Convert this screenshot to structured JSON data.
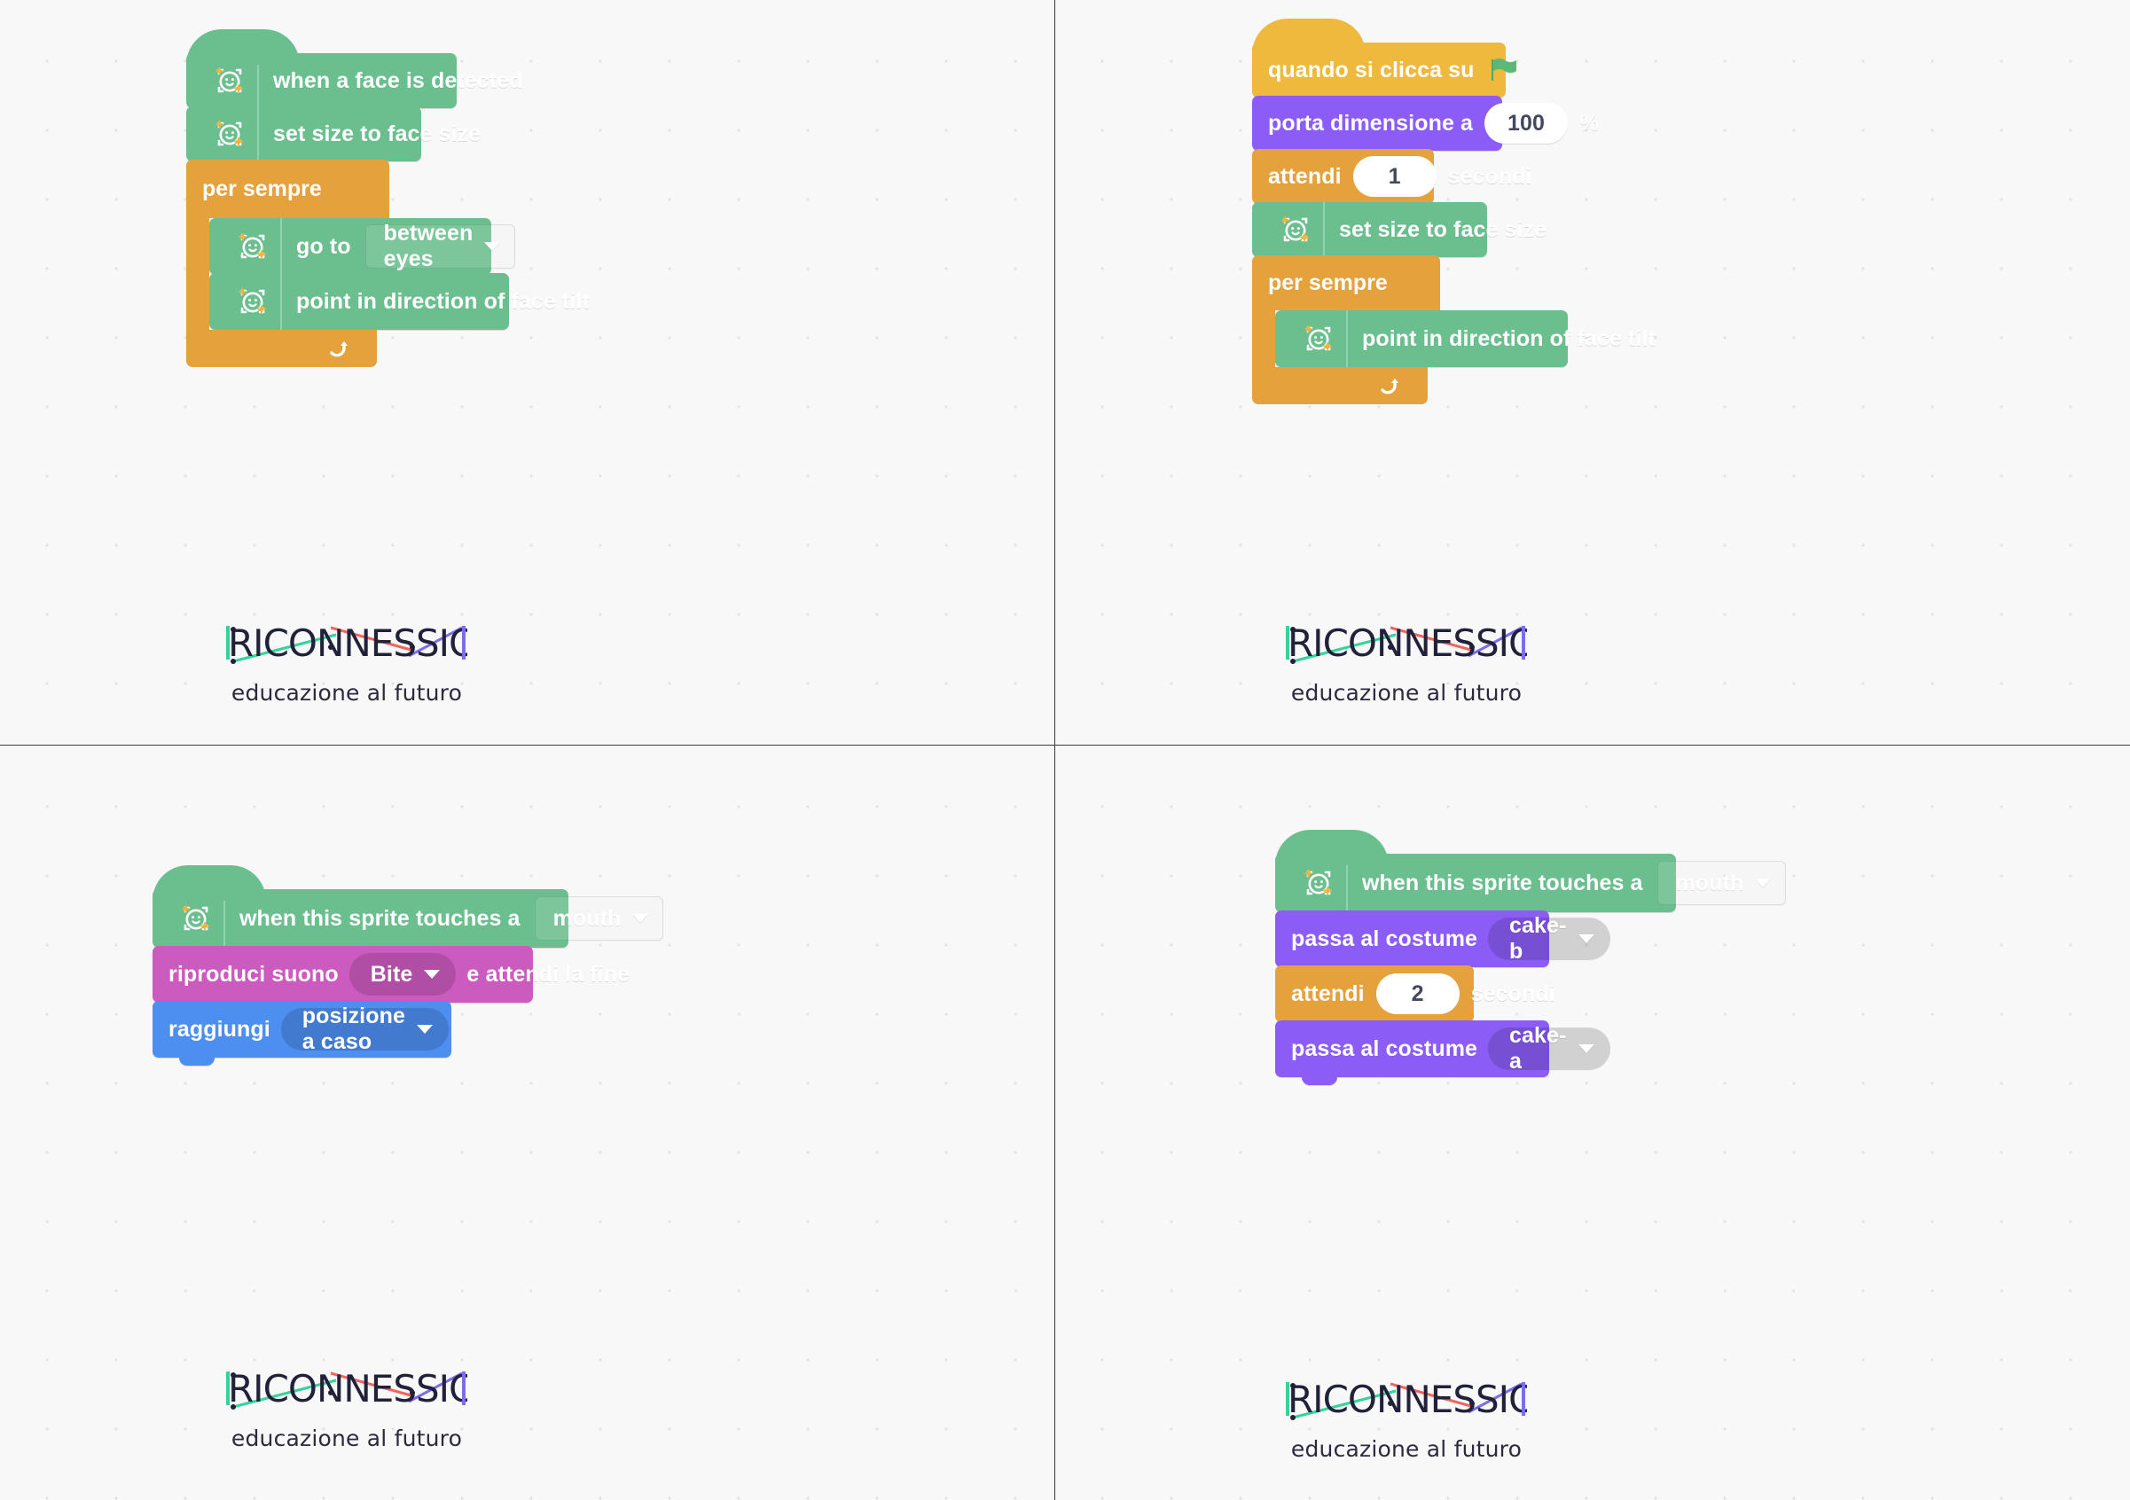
{
  "meta": {
    "kind": "scratch-block-scripts-sheet",
    "panel_count": 4
  },
  "colors": {
    "face_sensing": "#6bbf8f",
    "control": "#e5a13c",
    "events": "#eeb93c",
    "looks": "#8b5cf6",
    "sound": "#cc5bbf",
    "motion": "#4c8ff0",
    "background": "#f8f8f8",
    "logo_dark": "#21213a",
    "logo_green": "#34d399",
    "logo_red": "#f4645f",
    "logo_purple": "#7c6cf0"
  },
  "logo": {
    "wordmark": "RICONNESSIONI",
    "tagline": "educazione al futuro"
  },
  "panels": [
    {
      "id": "panel-top-left",
      "blocks": [
        {
          "type": "hat",
          "category": "face_sensing",
          "icon": "face-sensing-icon",
          "label": "when a face is detected"
        },
        {
          "type": "stack",
          "category": "face_sensing",
          "icon": "face-sensing-icon",
          "label": "set size to face size"
        },
        {
          "type": "c-block",
          "category": "control",
          "label": "per sempre",
          "children": [
            {
              "type": "stack",
              "category": "face_sensing",
              "icon": "face-sensing-icon",
              "label": "go to",
              "dropdown": {
                "style": "rect",
                "value": "between eyes"
              }
            },
            {
              "type": "stack",
              "category": "face_sensing",
              "icon": "face-sensing-icon",
              "label": "point in direction of face tilt"
            }
          ],
          "footer_icon": "loop-arrow-icon"
        }
      ]
    },
    {
      "id": "panel-top-right",
      "blocks": [
        {
          "type": "hat",
          "category": "events",
          "label": "quando si clicca su",
          "trailing_icon": "green-flag-icon"
        },
        {
          "type": "stack",
          "category": "looks",
          "label": "porta dimensione a",
          "number": "100",
          "label_after": "%"
        },
        {
          "type": "stack",
          "category": "control",
          "label": "attendi",
          "number": "1",
          "label_after": "secondi"
        },
        {
          "type": "stack",
          "category": "face_sensing",
          "icon": "face-sensing-icon",
          "label": "set size to face size"
        },
        {
          "type": "c-block",
          "category": "control",
          "label": "per sempre",
          "children": [
            {
              "type": "stack",
              "category": "face_sensing",
              "icon": "face-sensing-icon",
              "label": "point in direction of face tilt"
            }
          ],
          "footer_icon": "loop-arrow-icon"
        }
      ]
    },
    {
      "id": "panel-bottom-left",
      "blocks": [
        {
          "type": "hat",
          "category": "face_sensing",
          "icon": "face-sensing-icon",
          "label": "when this sprite touches a",
          "dropdown": {
            "style": "rect",
            "value": "mouth"
          }
        },
        {
          "type": "stack",
          "category": "sound",
          "label": "riproduci suono",
          "dropdown": {
            "style": "pill",
            "value": "Bite"
          },
          "label_after": "e attendi la fine"
        },
        {
          "type": "stack",
          "category": "motion",
          "label": "raggiungi",
          "dropdown": {
            "style": "pill",
            "value": "posizione a caso"
          }
        }
      ]
    },
    {
      "id": "panel-bottom-right",
      "blocks": [
        {
          "type": "hat",
          "category": "face_sensing",
          "icon": "face-sensing-icon",
          "label": "when this sprite touches a",
          "dropdown": {
            "style": "rect",
            "value": "mouth"
          }
        },
        {
          "type": "stack",
          "category": "looks",
          "label": "passa al costume",
          "dropdown": {
            "style": "pill",
            "value": "cake-b"
          }
        },
        {
          "type": "stack",
          "category": "control",
          "label": "attendi",
          "number": "2",
          "label_after": "secondi"
        },
        {
          "type": "stack",
          "category": "looks",
          "label": "passa al costume",
          "dropdown": {
            "style": "pill",
            "value": "cake-a"
          }
        }
      ]
    }
  ]
}
